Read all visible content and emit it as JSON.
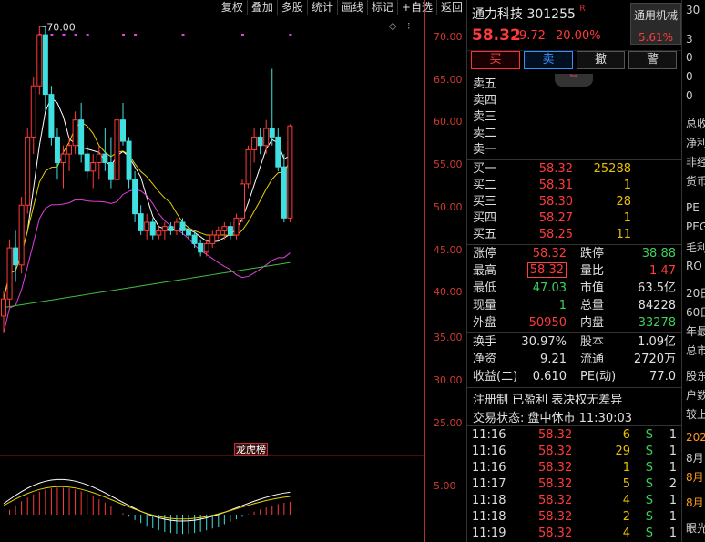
{
  "toolbar": {
    "buttons": [
      "复权",
      "叠加",
      "多股",
      "统计",
      "画线",
      "标记",
      "+自选",
      "返回"
    ]
  },
  "chart": {
    "price_axis": [
      "70.00",
      "65.00",
      "60.00",
      "55.00",
      "50.00",
      "45.00",
      "40.00",
      "35.00",
      "30.00",
      "25.00"
    ],
    "indicator_axis": [
      "5.00"
    ],
    "high_marker": "70.00",
    "lhb_badge": "龙虎榜"
  },
  "chart_data": {
    "type": "candlestick",
    "y_range": [
      22,
      72
    ],
    "candles": [
      [
        36,
        39,
        34,
        38
      ],
      [
        38,
        45,
        37,
        44
      ],
      [
        44,
        46,
        40,
        42
      ],
      [
        42,
        50,
        41,
        49
      ],
      [
        49,
        58,
        48,
        57
      ],
      [
        57,
        64,
        55,
        63
      ],
      [
        63,
        70,
        62,
        69
      ],
      [
        69,
        70,
        60,
        62
      ],
      [
        62,
        63,
        56,
        57
      ],
      [
        57,
        58,
        52,
        54
      ],
      [
        54,
        56,
        51,
        55
      ],
      [
        55,
        57,
        53,
        56
      ],
      [
        56,
        60,
        55,
        59
      ],
      [
        59,
        61,
        54,
        55
      ],
      [
        55,
        56,
        52,
        53
      ],
      [
        53,
        55,
        51,
        54
      ],
      [
        54,
        56,
        52,
        55
      ],
      [
        55,
        58,
        53,
        54
      ],
      [
        54,
        57,
        51,
        52
      ],
      [
        52,
        60,
        51,
        59
      ],
      [
        59,
        61,
        56,
        56.5
      ],
      [
        56.5,
        57,
        51,
        52
      ],
      [
        52,
        53,
        47,
        48
      ],
      [
        48,
        49,
        45.5,
        46
      ],
      [
        46,
        48,
        45,
        47
      ],
      [
        47,
        47.5,
        45,
        45.5
      ],
      [
        45.5,
        46.5,
        45,
        46
      ],
      [
        46,
        47,
        45,
        46.5
      ],
      [
        46.5,
        47,
        45.5,
        46
      ],
      [
        46,
        47.5,
        45.5,
        47
      ],
      [
        47,
        47.5,
        45.5,
        46
      ],
      [
        46,
        46.5,
        45,
        45.5
      ],
      [
        45.5,
        46,
        44,
        44.5
      ],
      [
        44.5,
        45,
        43,
        43.5
      ],
      [
        43.5,
        45,
        43,
        44.5
      ],
      [
        44.5,
        46,
        44,
        45.5
      ],
      [
        45.5,
        46.5,
        45,
        46
      ],
      [
        46,
        47,
        45,
        46.5
      ],
      [
        46.5,
        47,
        45,
        45.5
      ],
      [
        45.5,
        48,
        45,
        47.5
      ],
      [
        47.5,
        52,
        47,
        51.5
      ],
      [
        51.5,
        56,
        51,
        55.5
      ],
      [
        55.5,
        58,
        54,
        57
      ],
      [
        57,
        58,
        55,
        56
      ],
      [
        56,
        59,
        55,
        58
      ],
      [
        58,
        65,
        56,
        57
      ],
      [
        57,
        58,
        53,
        53.5
      ],
      [
        53.5,
        55,
        47,
        47.5
      ],
      [
        47.5,
        58.5,
        47,
        58.3
      ]
    ]
  },
  "quote": {
    "name": "通力科技 301255",
    "r_mark": "R",
    "last_price": "58.32",
    "change": "9.72",
    "change_pct": "20.00%",
    "tag_label": "通用机械",
    "tag_pct": "5.61%",
    "buy_label": "买",
    "sell_label": "卖",
    "cancel_label": "撤",
    "alert_label": "警",
    "asks": [
      {
        "label": "卖五",
        "price": "",
        "vol": ""
      },
      {
        "label": "卖四",
        "price": "",
        "vol": ""
      },
      {
        "label": "卖三",
        "price": "",
        "vol": ""
      },
      {
        "label": "卖二",
        "price": "",
        "vol": ""
      },
      {
        "label": "卖一",
        "price": "",
        "vol": ""
      }
    ],
    "bids": [
      {
        "label": "买一",
        "price": "58.32",
        "vol": "25288"
      },
      {
        "label": "买二",
        "price": "58.31",
        "vol": "1"
      },
      {
        "label": "买三",
        "price": "58.30",
        "vol": "28"
      },
      {
        "label": "买四",
        "price": "58.27",
        "vol": "1"
      },
      {
        "label": "买五",
        "price": "58.25",
        "vol": "11"
      }
    ],
    "stats1": [
      {
        "k1": "涨停",
        "v1": "58.32",
        "c1": "red",
        "k2": "跌停",
        "v2": "38.88",
        "c2": "green"
      },
      {
        "k1": "最高",
        "v1": "58.32",
        "c1": "red boxed",
        "k2": "量比",
        "v2": "1.47",
        "c2": "red"
      },
      {
        "k1": "最低",
        "v1": "47.03",
        "c1": "green",
        "k2": "市值",
        "v2": "63.5亿",
        "c2": "white"
      },
      {
        "k1": "现量",
        "v1": "1",
        "c1": "green",
        "k2": "总量",
        "v2": "84228",
        "c2": "white"
      },
      {
        "k1": "外盘",
        "v1": "50950",
        "c1": "red",
        "k2": "内盘",
        "v2": "33278",
        "c2": "green"
      }
    ],
    "stats2": [
      {
        "k1": "换手",
        "v1": "30.97%",
        "c1": "white",
        "k2": "股本",
        "v2": "1.09亿",
        "c2": "white"
      },
      {
        "k1": "净资",
        "v1": "9.21",
        "c1": "white",
        "k2": "流通",
        "v2": "2720万",
        "c2": "white"
      },
      {
        "k1": "收益(二)",
        "v1": "0.610",
        "c1": "white",
        "k2": "PE(动)",
        "v2": "77.0",
        "c2": "white"
      }
    ],
    "tags_line": "注册制 已盈利 表决权无差异",
    "status_line": "交易状态: 盘中休市 11:30:03",
    "ticks": [
      {
        "time": "11:16",
        "price": "58.32",
        "vol": "6",
        "side": "S",
        "num": "1"
      },
      {
        "time": "11:16",
        "price": "58.32",
        "vol": "29",
        "side": "S",
        "num": "1"
      },
      {
        "time": "11:16",
        "price": "58.32",
        "vol": "1",
        "side": "S",
        "num": "1"
      },
      {
        "time": "11:17",
        "price": "58.32",
        "vol": "5",
        "side": "S",
        "num": "2"
      },
      {
        "time": "11:18",
        "price": "58.32",
        "vol": "4",
        "side": "S",
        "num": "1"
      },
      {
        "time": "11:18",
        "price": "58.32",
        "vol": "2",
        "side": "S",
        "num": "1"
      },
      {
        "time": "11:19",
        "price": "58.32",
        "vol": "4",
        "side": "S",
        "num": "1"
      }
    ]
  },
  "side_info": {
    "items": [
      "30",
      "3",
      "0",
      "0",
      "0",
      "总收",
      "净利",
      "非经",
      "货币",
      "PE",
      "PEG",
      "毛利",
      "RO",
      "20日",
      "60日",
      "年最",
      "总市",
      "股东",
      "户数",
      "较上",
      "202",
      "8月",
      "8月",
      "8月",
      "眼光"
    ]
  }
}
